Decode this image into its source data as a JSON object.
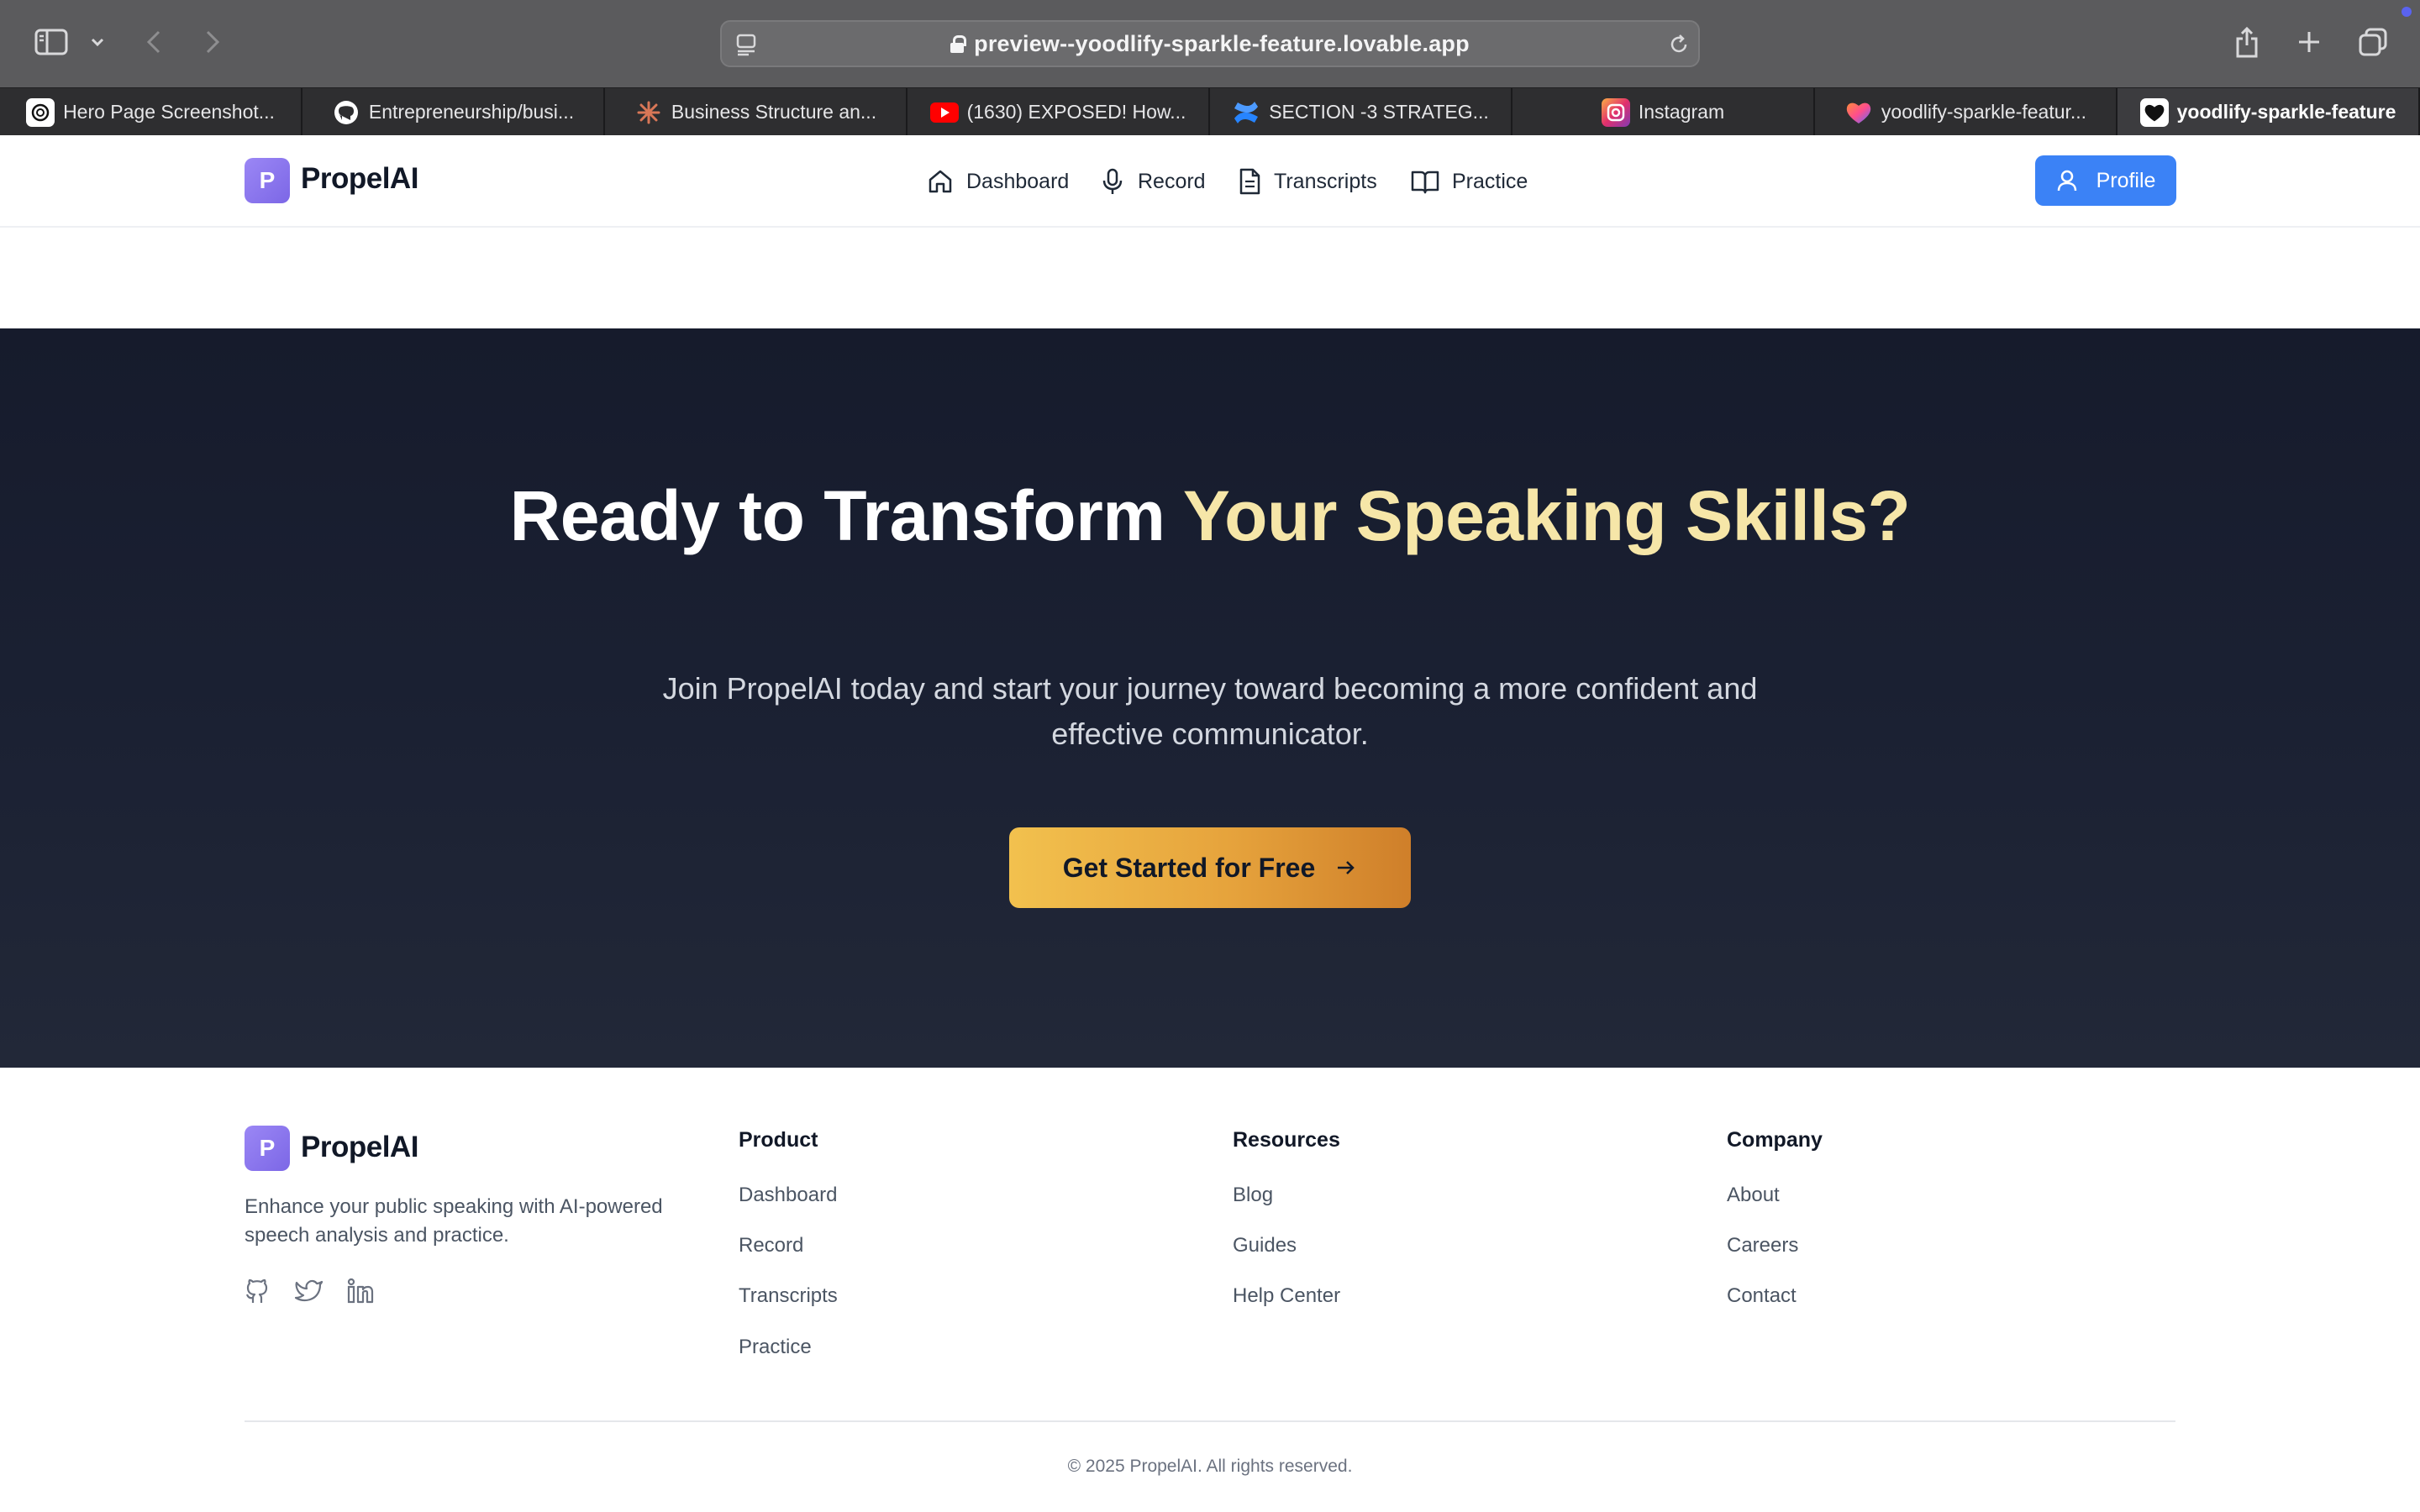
{
  "browser": {
    "url": "preview--yoodlify-sparkle-feature.lovable.app",
    "tabs": [
      {
        "title": "Hero Page Screenshot...",
        "favicon": "openai-icon"
      },
      {
        "title": "Entrepreneurship/busi...",
        "favicon": "github-icon"
      },
      {
        "title": "Business Structure an...",
        "favicon": "claude-icon"
      },
      {
        "title": "(1630) EXPOSED! How...",
        "favicon": "youtube-icon"
      },
      {
        "title": "SECTION -3 STRATEG...",
        "favicon": "confluence-icon"
      },
      {
        "title": "Instagram",
        "favicon": "instagram-icon"
      },
      {
        "title": "yoodlify-sparkle-featur...",
        "favicon": "lovable-heart-icon"
      },
      {
        "title": "yoodlify-sparkle-feature",
        "favicon": "heart-icon",
        "active": true
      }
    ]
  },
  "nav": {
    "logo_letter": "P",
    "brand": "PropelAI",
    "links": [
      {
        "label": "Dashboard",
        "icon": "home-icon"
      },
      {
        "label": "Record",
        "icon": "microphone-icon"
      },
      {
        "label": "Transcripts",
        "icon": "document-icon"
      },
      {
        "label": "Practice",
        "icon": "book-icon"
      }
    ],
    "profile_label": "Profile",
    "accent_color": "#3b82f6"
  },
  "hero": {
    "title_white": "Ready to Transform ",
    "title_accent": "Your Speaking Skills?",
    "subtitle": "Join PropelAI today and start your journey toward becoming a more confident and effective communicator.",
    "cta_label": "Get Started for Free",
    "cta_gradient": [
      "#f2c14e",
      "#cf7f2a"
    ]
  },
  "footer": {
    "logo_letter": "P",
    "brand": "PropelAI",
    "description": "Enhance your public speaking with AI-powered speech analysis and practice.",
    "social": [
      "github-icon",
      "twitter-icon",
      "linkedin-icon"
    ],
    "columns": [
      {
        "title": "Product",
        "links": [
          "Dashboard",
          "Record",
          "Transcripts",
          "Practice"
        ]
      },
      {
        "title": "Resources",
        "links": [
          "Blog",
          "Guides",
          "Help Center"
        ]
      },
      {
        "title": "Company",
        "links": [
          "About",
          "Careers",
          "Contact"
        ]
      }
    ],
    "copyright": "© 2025 PropelAI. All rights reserved."
  }
}
